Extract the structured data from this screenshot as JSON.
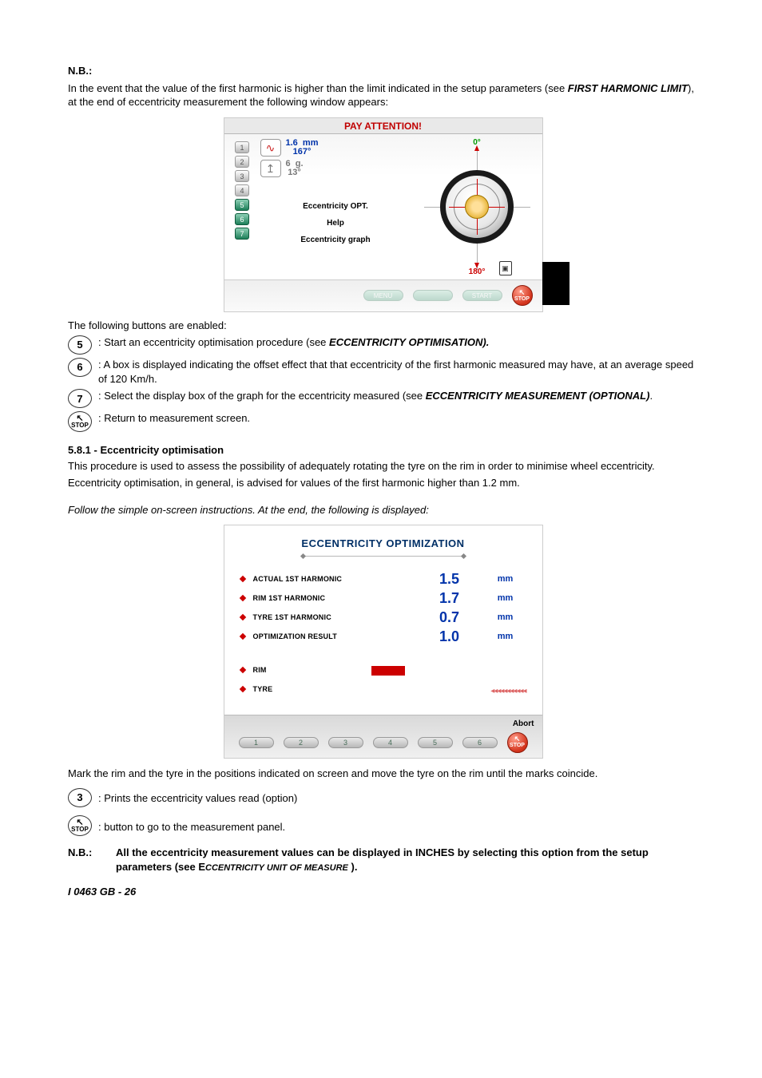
{
  "intro": {
    "nb": "N.B.:",
    "line1a": "In the event that the value of the first harmonic is higher than the limit indicated in the setup parameters (see ",
    "line1b": "FIRST HARMONIC LIMIT",
    "line1c": "), at the end of eccentricity measurement the following window appears:"
  },
  "shot1": {
    "title": "PAY ATTENTION!",
    "metric1_value": "1.6",
    "metric1_unit": "mm",
    "metric1_angle": "167°",
    "metric2_value": "6",
    "metric2_unit": "g.",
    "metric2_angle": "13°",
    "menu5": "Eccentricity OPT.",
    "menu6": "Help",
    "menu7": "Eccentricity graph",
    "deg0": "0°",
    "deg180": "180°",
    "bot_menu": "MENU",
    "bot_start": "START",
    "bot_stop": "STOP"
  },
  "enabled_intro": "The following buttons are enabled:",
  "btns1": {
    "b5_num": "5",
    "b5_a": " : Start an eccentricity optimisation procedure (see ",
    "b5_b": "ECCENTRICITY OPTIMISATION).",
    "b6_num": "6",
    "b6": " : A box is displayed indicating the offset effect that that eccentricity of the first harmonic measured may have, at an average speed of 120 Km/h.",
    "b7_num": "7",
    "b7_a": " : Select the display box of the graph for the eccentricity measured (see ",
    "b7_b": "ECCENTRICITY MEASUREMENT (OPTIONAL)",
    "b7_c": ".",
    "stop_label": "STOP",
    "stop_txt": " : Return to measurement screen."
  },
  "section": {
    "head": "5.8.1 - Eccentricity optimisation",
    "p1": "This procedure is used to assess the possibility of adequately rotating the tyre on the rim in order to minimise wheel eccentricity.",
    "p2": "Eccentricity optimisation, in general, is advised for values of the first harmonic higher than 1.2 mm.",
    "p3": "Follow the simple on-screen instructions. At the end, the following is displayed:"
  },
  "shot2": {
    "title": "ECCENTRICITY OPTIMIZATION",
    "rows": [
      {
        "label": "ACTUAL 1ST HARMONIC",
        "value": "1.5",
        "unit": "mm"
      },
      {
        "label": "RIM 1ST HARMONIC",
        "value": "1.7",
        "unit": "mm"
      },
      {
        "label": "TYRE 1ST HARMONIC",
        "value": "0.7",
        "unit": "mm"
      },
      {
        "label": "OPTIMIZATION RESULT",
        "value": "1.0",
        "unit": "mm"
      }
    ],
    "rim": "RIM",
    "tyre": "TYRE",
    "arrows": "◂◂◂◂◂◂◂◂◂◂◂",
    "abort": "Abort",
    "stop": "STOP"
  },
  "after2": {
    "mark": "Mark the rim and the tyre in the positions indicated on screen and move the tyre on the rim until the marks coincide.",
    "b3_num": "3",
    "b3": " : Prints the eccentricity values read (option)",
    "stop_label": "STOP",
    "stop_txt": " : button to go to the measurement panel."
  },
  "nb2": {
    "nb": "N.B.:",
    "txt_a": "All the eccentricity measurement values can be displayed in INCHES by selecting this option from the setup parameters (see E",
    "txt_b": "CCENTRICITY UNIT OF MEASURE",
    "txt_c": " )."
  },
  "footer": "I 0463  GB - 26"
}
